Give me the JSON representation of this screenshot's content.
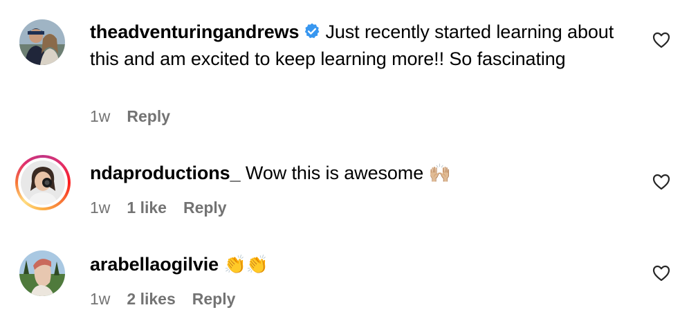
{
  "comments": [
    {
      "username": "theadventuringandrews",
      "verified": true,
      "text": "Just recently started learning about this and am excited to keep learning more!! So fascinating",
      "time": "1w",
      "likes": "",
      "reply": "Reply",
      "has_story": false
    },
    {
      "username": "ndaproductions_",
      "verified": false,
      "text": "Wow this is awesome",
      "emoji": "🙌🏼",
      "time": "1w",
      "likes": "1 like",
      "reply": "Reply",
      "has_story": true
    },
    {
      "username": "arabellaogilvie",
      "verified": false,
      "text": "",
      "emoji": "👏👏",
      "time": "1w",
      "likes": "2 likes",
      "reply": "Reply",
      "has_story": false
    }
  ],
  "colors": {
    "verified_badge": "#3897f0",
    "meta_text": "#737373",
    "story_ring_start": "#c13584",
    "story_ring_end": "#fcaf45"
  },
  "icons": {
    "like": "heart-outline-icon",
    "verified": "verified-badge-icon"
  }
}
